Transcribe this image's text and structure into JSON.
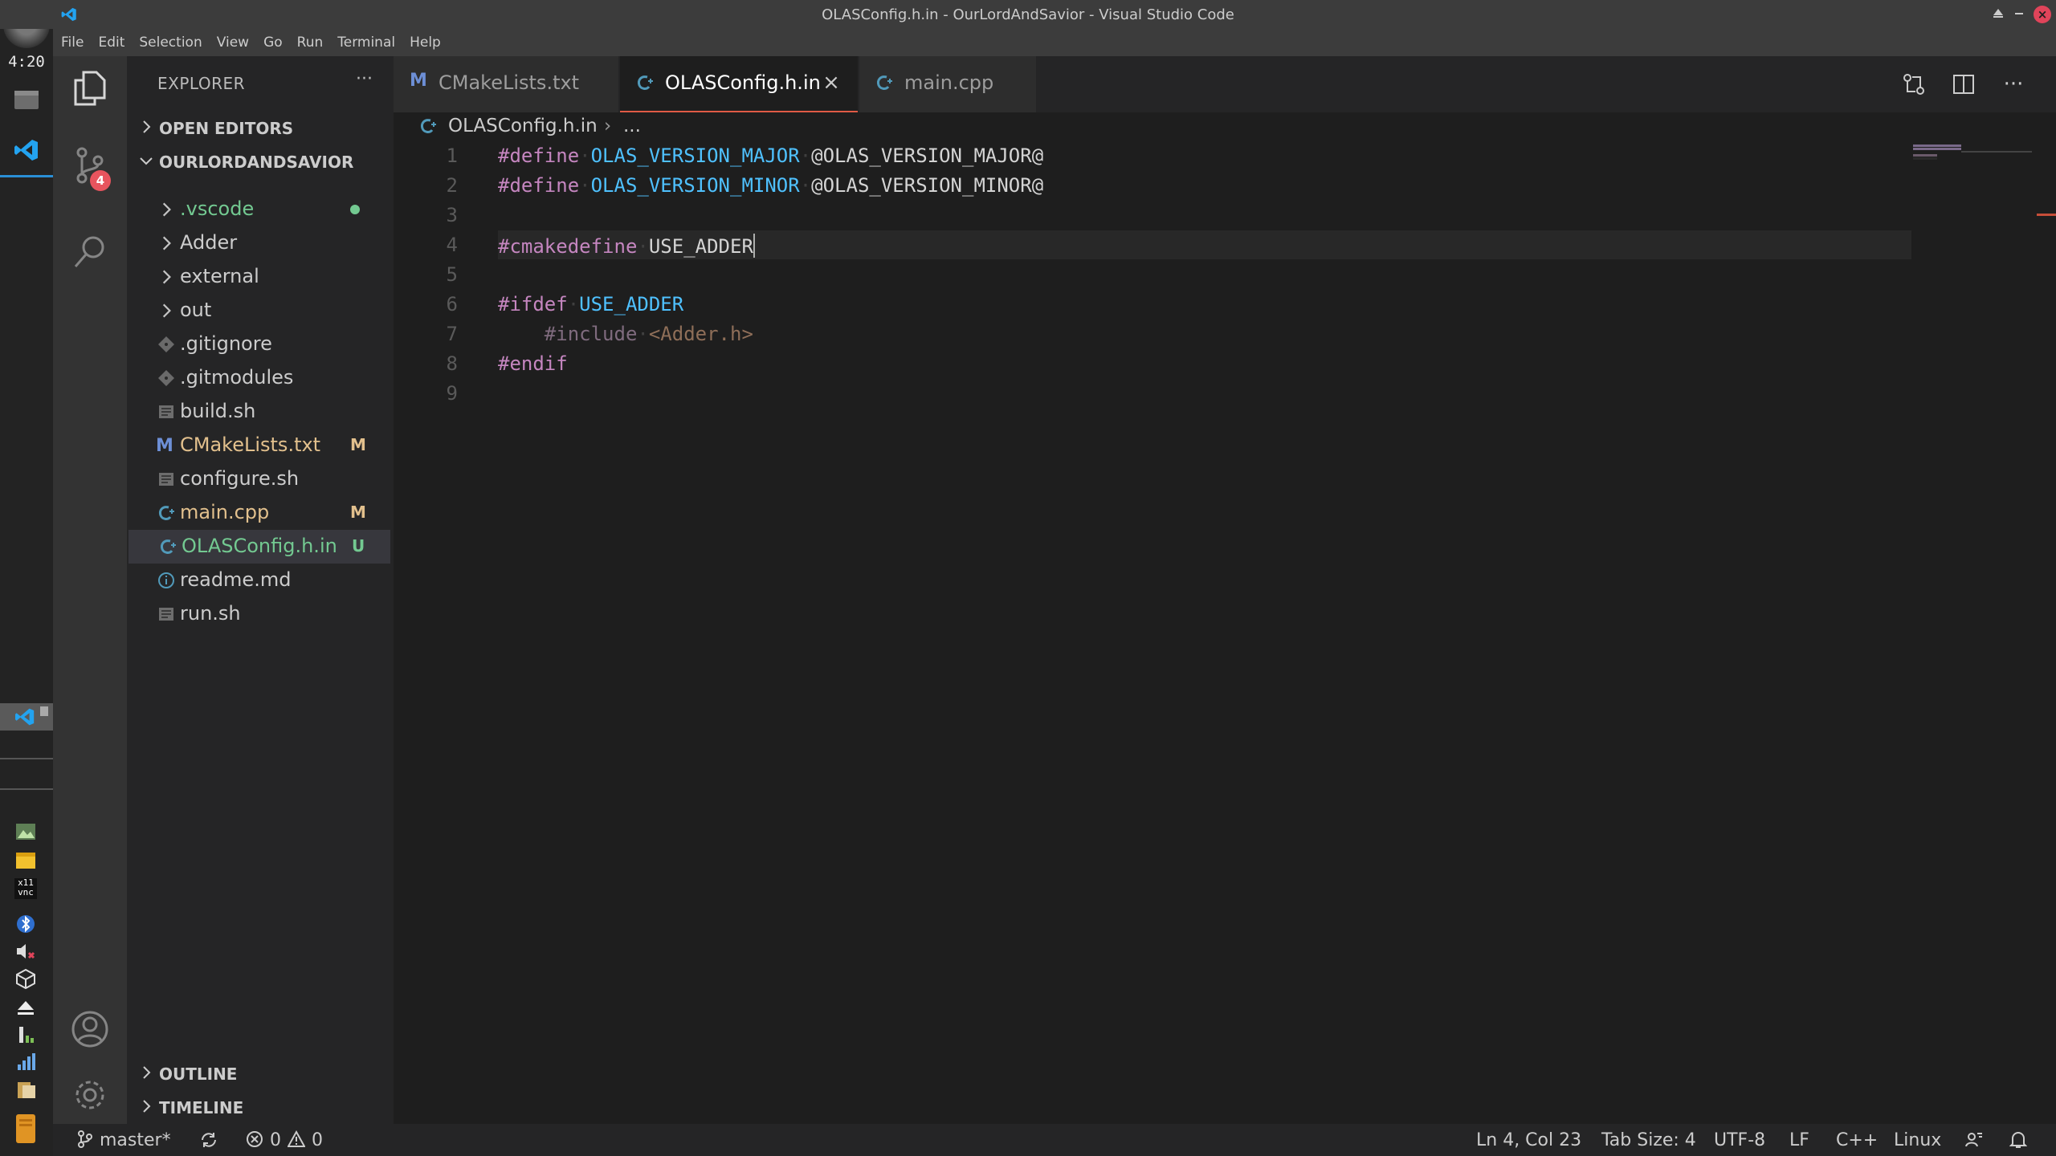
{
  "window": {
    "title": "OLASConfig.h.in - OurLordAndSavior - Visual Studio Code"
  },
  "menu": [
    "File",
    "Edit",
    "Selection",
    "View",
    "Go",
    "Run",
    "Terminal",
    "Help"
  ],
  "taskbar": {
    "clock": "4:20",
    "tray_vnc_label": "x11\nvnc"
  },
  "activity": {
    "scm_badge": "4"
  },
  "sidebar": {
    "title": "EXPLORER",
    "more": "···",
    "open_editors": "OPEN EDITORS",
    "workspace": "OURLORDANDSAVIOR",
    "outline": "OUTLINE",
    "timeline": "TIMELINE",
    "tree": [
      {
        "label": ".vscode",
        "kind": "folder",
        "color": "#73c991",
        "deco": "dot"
      },
      {
        "label": "Adder",
        "kind": "folder",
        "color": "#cccccc",
        "deco": ""
      },
      {
        "label": "external",
        "kind": "folder",
        "color": "#cccccc",
        "deco": ""
      },
      {
        "label": "out",
        "kind": "folder",
        "color": "#cccccc",
        "deco": ""
      },
      {
        "label": ".gitignore",
        "kind": "git",
        "color": "#cccccc",
        "deco": ""
      },
      {
        "label": ".gitmodules",
        "kind": "git",
        "color": "#cccccc",
        "deco": ""
      },
      {
        "label": "build.sh",
        "kind": "file",
        "color": "#cccccc",
        "deco": ""
      },
      {
        "label": "CMakeLists.txt",
        "kind": "cmake",
        "color": "#e2c08d",
        "deco": "M"
      },
      {
        "label": "configure.sh",
        "kind": "file",
        "color": "#cccccc",
        "deco": ""
      },
      {
        "label": "main.cpp",
        "kind": "cpp",
        "color": "#e2c08d",
        "deco": "M"
      },
      {
        "label": "OLASConfig.h.in",
        "kind": "cpp",
        "color": "#73c991",
        "deco": "U"
      },
      {
        "label": "readme.md",
        "kind": "info",
        "color": "#cccccc",
        "deco": ""
      },
      {
        "label": "run.sh",
        "kind": "file",
        "color": "#cccccc",
        "deco": ""
      }
    ]
  },
  "tabs": [
    {
      "label": "CMakeLists.txt",
      "kind": "cmake",
      "active": false
    },
    {
      "label": "OLASConfig.h.in",
      "kind": "cpp",
      "active": true,
      "close": "×"
    },
    {
      "label": "main.cpp",
      "kind": "cpp",
      "active": false
    }
  ],
  "breadcrumb": {
    "file": "OLASConfig.h.in",
    "separator": "›",
    "rest": "..."
  },
  "editor": {
    "lines": [
      {
        "n": "1",
        "tokens": [
          [
            "dir",
            "#define"
          ],
          [
            "ws",
            "·"
          ],
          [
            "mac",
            "OLAS_VERSION_MAJOR"
          ],
          [
            "ws",
            "·"
          ],
          [
            "txt",
            "@OLAS_VERSION_MAJOR@"
          ]
        ]
      },
      {
        "n": "2",
        "tokens": [
          [
            "dir",
            "#define"
          ],
          [
            "ws",
            "·"
          ],
          [
            "mac",
            "OLAS_VERSION_MINOR"
          ],
          [
            "ws",
            "·"
          ],
          [
            "txt",
            "@OLAS_VERSION_MINOR@"
          ]
        ]
      },
      {
        "n": "3",
        "tokens": []
      },
      {
        "n": "4",
        "tokens": [
          [
            "dir",
            "#cmakedefine"
          ],
          [
            "ws",
            "·"
          ],
          [
            "txt",
            "USE_ADDER"
          ]
        ],
        "current": true
      },
      {
        "n": "5",
        "tokens": []
      },
      {
        "n": "6",
        "tokens": [
          [
            "dir",
            "#ifdef"
          ],
          [
            "ws",
            "·"
          ],
          [
            "mac",
            "USE_ADDER"
          ]
        ]
      },
      {
        "n": "7",
        "tokens": [
          [
            "ws",
            "    "
          ],
          [
            "dimdir",
            "#include"
          ],
          [
            "ws",
            "·"
          ],
          [
            "diminc",
            "<Adder.h>"
          ]
        ]
      },
      {
        "n": "8",
        "tokens": [
          [
            "dir",
            "#endif"
          ]
        ]
      },
      {
        "n": "9",
        "tokens": []
      }
    ]
  },
  "status": {
    "branch": "master*",
    "errors": "0",
    "warnings": "0",
    "position": "Ln 4, Col 23",
    "tab_size": "Tab Size: 4",
    "encoding": "UTF-8",
    "eol": "LF",
    "language": "C++",
    "platform": "Linux"
  },
  "colors": {
    "accent_tab": "#e05a45",
    "modified": "#e2c08d",
    "untracked": "#73c991",
    "badge": "#e8545e"
  }
}
